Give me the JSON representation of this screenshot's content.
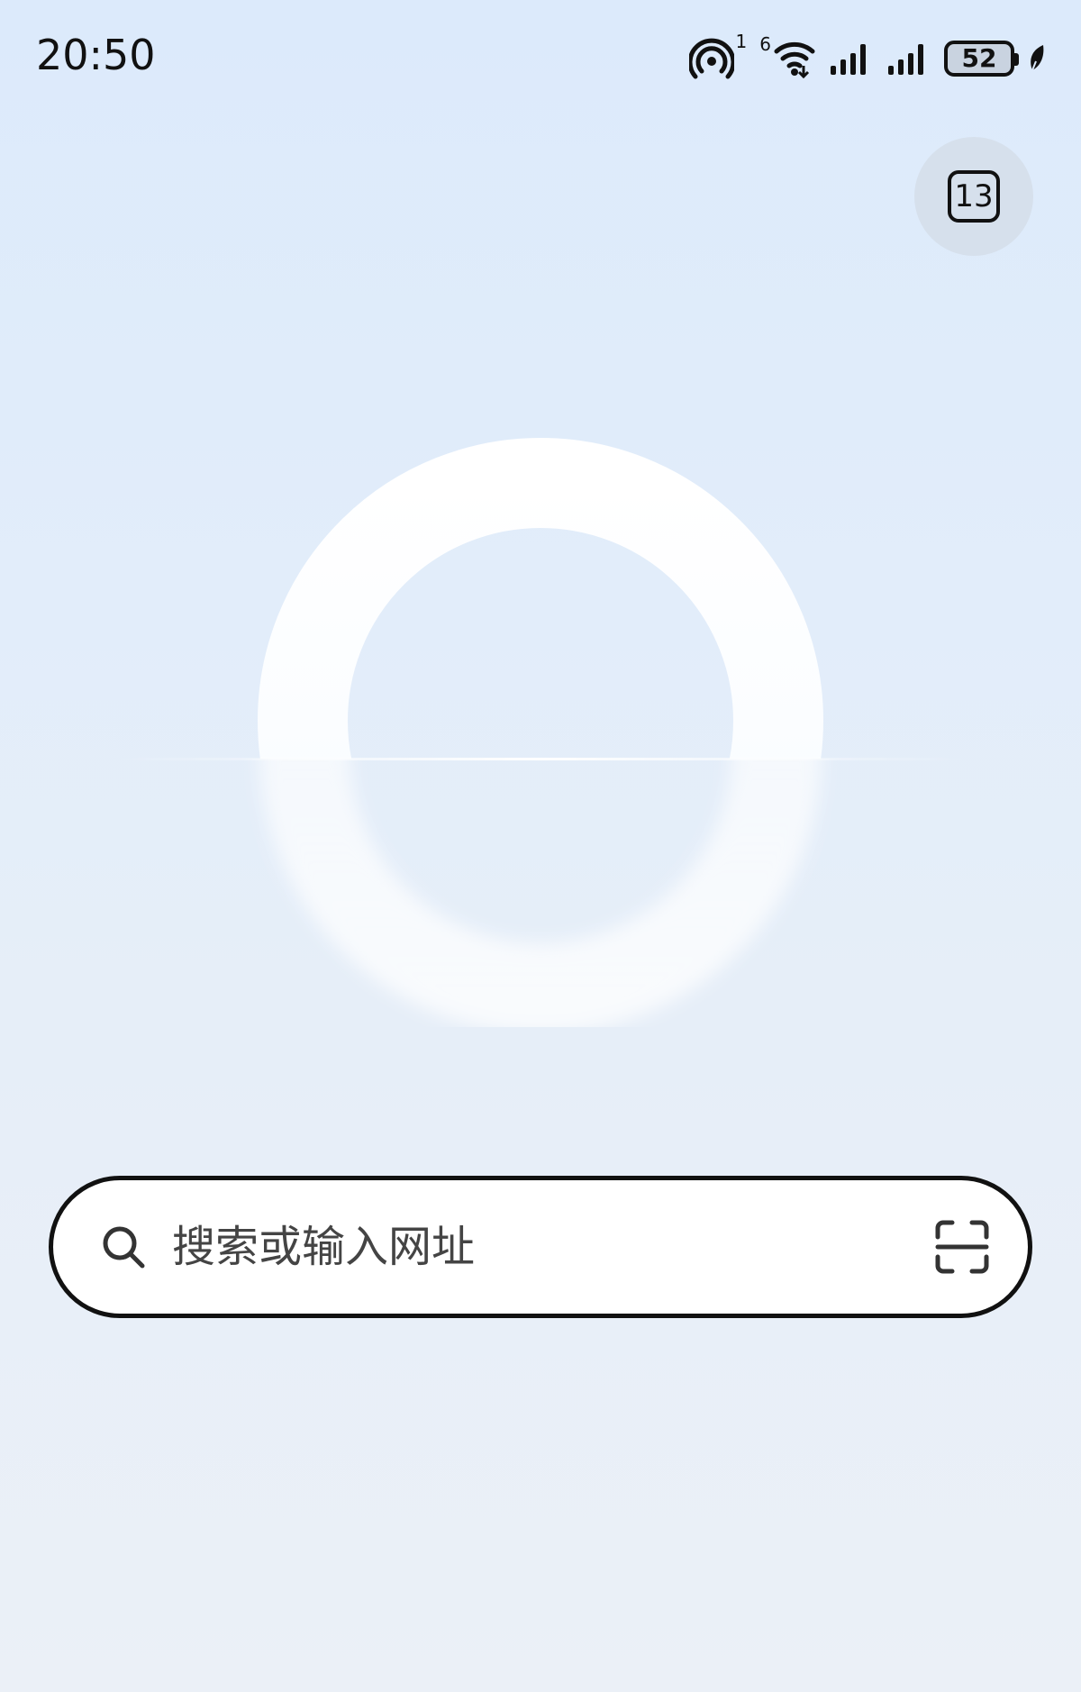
{
  "status_bar": {
    "time": "20:50",
    "hotspot_badge": "1",
    "wifi_badge": "6",
    "battery_level": "52"
  },
  "tabs": {
    "count": "13"
  },
  "search": {
    "placeholder": "搜索或输入网址",
    "value": ""
  },
  "icons": {
    "hotspot": "hotspot-icon",
    "wifi": "wifi-icon",
    "signal_1": "signal-icon",
    "signal_2": "signal-icon",
    "battery": "battery-icon",
    "leaf": "leaf-icon",
    "search": "search-icon",
    "scan": "scan-icon"
  },
  "colors": {
    "background_top": "#dceafb",
    "background_bottom": "#ebf0f7",
    "tabs_button_bg": "#d6e0ec",
    "search_bg": "#ffffff",
    "ink": "#111111"
  }
}
